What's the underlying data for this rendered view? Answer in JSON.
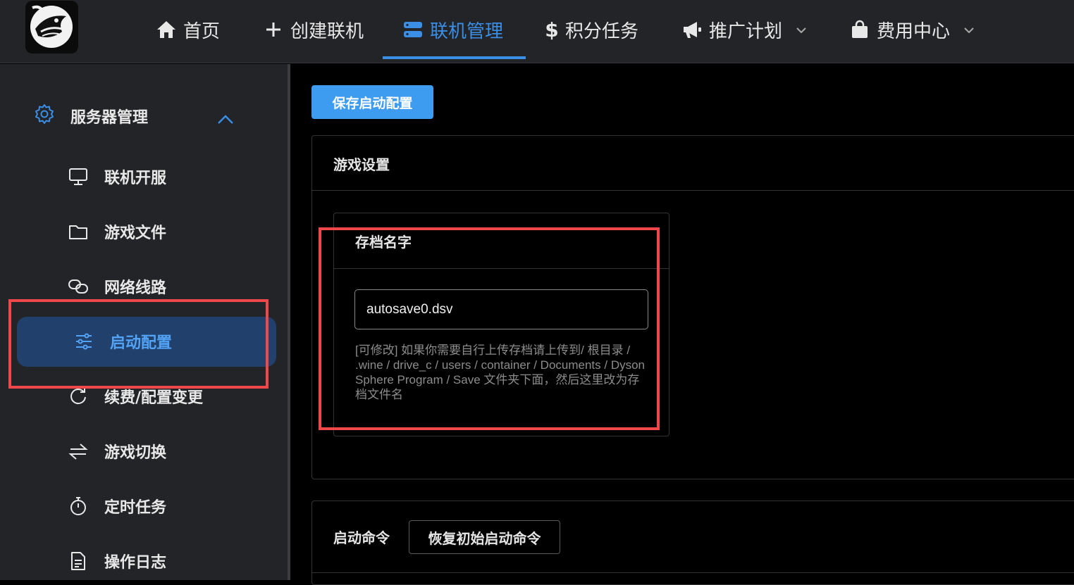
{
  "topnav": {
    "items": [
      {
        "label": "首页",
        "icon": "home-icon"
      },
      {
        "label": "创建联机",
        "icon": "plus-icon"
      },
      {
        "label": "联机管理",
        "icon": "server-icon",
        "active": true
      },
      {
        "label": "积分任务",
        "icon": "dollar-icon"
      },
      {
        "label": "推广计划",
        "icon": "megaphone-icon",
        "dropdown": true
      },
      {
        "label": "费用中心",
        "icon": "shopping-bag-icon",
        "dropdown": true
      }
    ],
    "dollar_glyph": "$",
    "accent_color": "#3a8ee6"
  },
  "sidebar": {
    "group_label": "服务器管理",
    "items": [
      {
        "label": "联机开服",
        "icon": "monitor-icon"
      },
      {
        "label": "游戏文件",
        "icon": "folder-icon"
      },
      {
        "label": "网络线路",
        "icon": "link-icon"
      },
      {
        "label": "启动配置",
        "icon": "sliders-icon",
        "active": true
      },
      {
        "label": "续费/配置变更",
        "icon": "refresh-icon"
      },
      {
        "label": "游戏切换",
        "icon": "switch-icon"
      },
      {
        "label": "定时任务",
        "icon": "stopwatch-icon"
      },
      {
        "label": "操作日志",
        "icon": "document-icon"
      }
    ]
  },
  "main": {
    "save_button": "保存启动配置",
    "game_settings_title": "游戏设置",
    "save_name_label": "存档名字",
    "save_name_value": "autosave0.dsv",
    "save_name_hint": "[可修改] 如果你需要自行上传存档请上传到/ 根目录 / .wine / drive_c / users / container / Documents / Dyson Sphere Program / Save 文件夹下面，然后这里改为存档文件名",
    "launch_cmd_title": "启动命令",
    "reset_button": "恢复初始启动命令"
  },
  "highlight_color": "#f0474b"
}
